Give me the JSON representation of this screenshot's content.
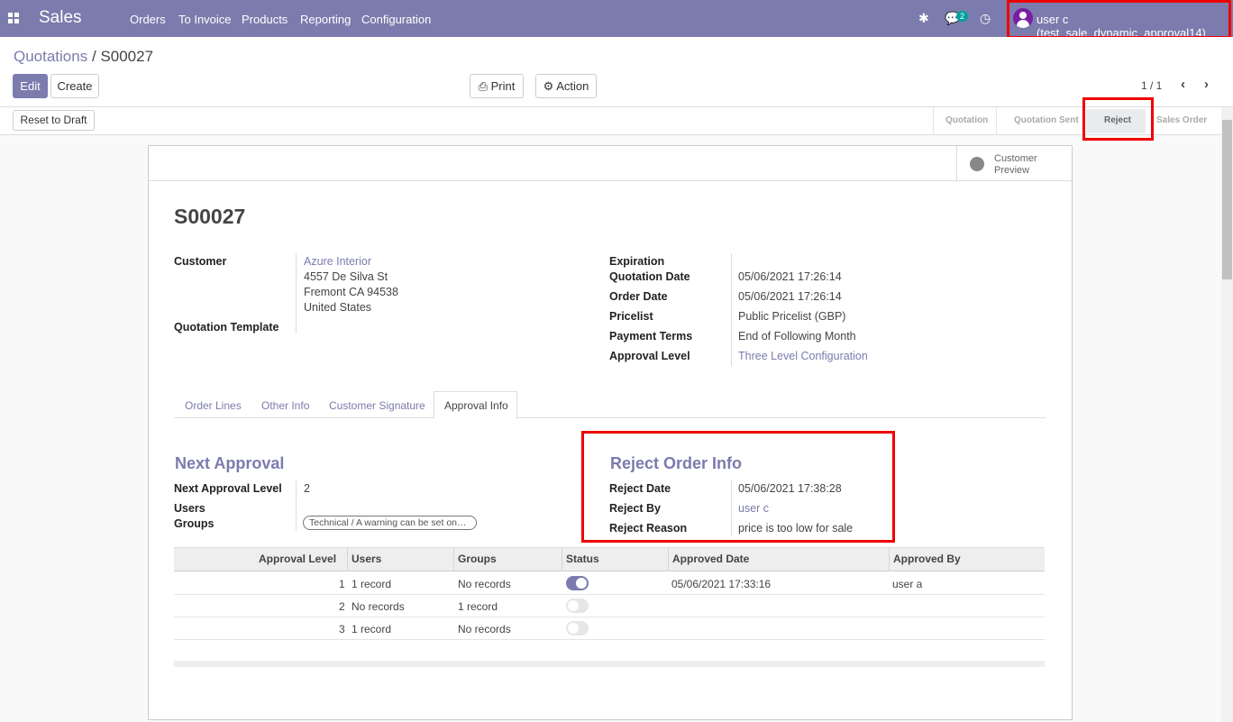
{
  "navbar": {
    "brand": "Sales",
    "menu": [
      "Orders",
      "To Invoice",
      "Products",
      "Reporting",
      "Configuration"
    ],
    "messages_count": "2",
    "user": "user c (test_sale_dynamic_approval14)"
  },
  "breadcrumb": {
    "parent": "Quotations",
    "separator": "/",
    "current": "S00027"
  },
  "toolbar": {
    "edit": "Edit",
    "create": "Create",
    "print": "Print",
    "action": "Action",
    "pager": "1 / 1"
  },
  "statusbar": {
    "reset_button": "Reset to Draft",
    "steps": [
      "Quotation",
      "Quotation Sent",
      "Reject",
      "Sales Order"
    ],
    "active": "Reject"
  },
  "preview": {
    "label_line1": "Customer",
    "label_line2": "Preview"
  },
  "record": {
    "name": "S00027",
    "customer_label": "Customer",
    "customer_name": "Azure Interior",
    "address_line1": "4557 De Silva St",
    "address_line2": "Fremont CA 94538",
    "address_line3": "United States",
    "template_label": "Quotation Template",
    "expiration_label": "Expiration",
    "quotation_date_label": "Quotation Date",
    "quotation_date": "05/06/2021 17:26:14",
    "order_date_label": "Order Date",
    "order_date": "05/06/2021 17:26:14",
    "pricelist_label": "Pricelist",
    "pricelist": "Public Pricelist (GBP)",
    "payment_terms_label": "Payment Terms",
    "payment_terms": "End of Following Month",
    "approval_level_label": "Approval Level",
    "approval_level": "Three Level Configuration"
  },
  "tabs": [
    "Order Lines",
    "Other Info",
    "Customer Signature",
    "Approval Info"
  ],
  "active_tab": "Approval Info",
  "next_approval": {
    "title": "Next Approval",
    "level_label": "Next Approval Level",
    "level": "2",
    "users_label": "Users",
    "groups_label": "Groups",
    "group_tag": "Technical / A warning can be set on…"
  },
  "reject_info": {
    "title": "Reject Order Info",
    "date_label": "Reject Date",
    "date": "05/06/2021 17:38:28",
    "by_label": "Reject By",
    "by": "user c",
    "reason_label": "Reject Reason",
    "reason": "price is too low for sale"
  },
  "approval_table": {
    "headers": [
      "Approval Level",
      "Users",
      "Groups",
      "Status",
      "Approved Date",
      "Approved By"
    ],
    "rows": [
      {
        "level": "1",
        "users": "1 record",
        "groups": "No records",
        "status": true,
        "date": "05/06/2021 17:33:16",
        "by": "user a"
      },
      {
        "level": "2",
        "users": "No records",
        "groups": "1 record",
        "status": false,
        "date": "",
        "by": ""
      },
      {
        "level": "3",
        "users": "1 record",
        "groups": "No records",
        "status": false,
        "date": "",
        "by": ""
      }
    ]
  }
}
